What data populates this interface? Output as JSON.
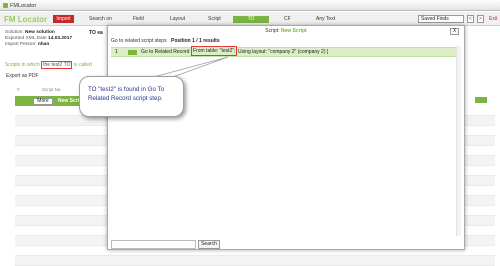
{
  "window": {
    "title": "FMLocator"
  },
  "header": {
    "logo": "FM Locator",
    "import_label": "Import",
    "nav": [
      {
        "label": "Search on",
        "active": false
      },
      {
        "label": "Field",
        "active": false
      },
      {
        "label": "Layout",
        "active": false
      },
      {
        "label": "Script",
        "active": false
      },
      {
        "label": "TO",
        "active": true
      },
      {
        "label": "CF",
        "active": false
      },
      {
        "label": "Any Text",
        "active": false
      }
    ],
    "saved_finds": "Saved Finds",
    "prev": "<",
    "next": ">",
    "exit": "Exit"
  },
  "info": {
    "solution_label": "Solution:",
    "solution_value": "New solution",
    "exported_label": "Exported XML Date",
    "exported_value": "14.03.2017",
    "person_label": "Import Person:",
    "person_value": "nhan",
    "to_prefix": "TO ea"
  },
  "main": {
    "scripts_prefix": "Scripts in which",
    "scripts_highlight": "the test2 TO",
    "scripts_suffix": "is called",
    "export_label": "Export as PDF",
    "col_hash": "#",
    "col_script": "Script Na",
    "more_label": "More",
    "row_label": "New Scri"
  },
  "dialog": {
    "title_prefix": "Script:",
    "title_name": "New Script",
    "close": "X",
    "goto_label": "Go to related script steps",
    "position_label": "Position 1 / 1 results",
    "step_num": "1",
    "step_name": "Go to Related Record",
    "step_highlight": "From table: \"test2\";",
    "step_rest": "Using layout: \"company 2\" (company 2) ]",
    "search_placeholder": "",
    "search_label": "Search"
  },
  "callout": {
    "line1": "TO \"test2\" is found in Go To",
    "line2": "Related Record script step."
  },
  "colors": {
    "brand_green": "#7cb342",
    "highlight_red": "#e53935",
    "import_red": "#c62828",
    "callout_text": "#283593"
  }
}
